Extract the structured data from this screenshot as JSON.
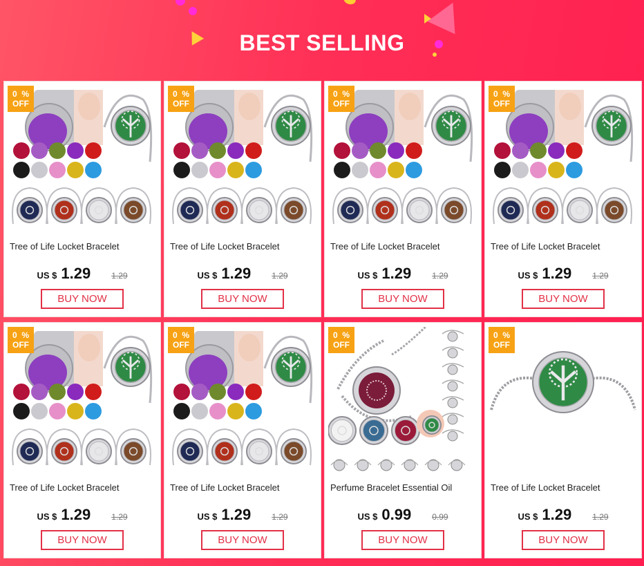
{
  "header": {
    "title": "BEST SELLING"
  },
  "products": [
    {
      "discount_value": "0",
      "discount_unit": "%",
      "discount_label": "OFF",
      "title": "Tree of Life Locket Bracelet",
      "currency": "US $",
      "price": "1.29",
      "original_price": "1.29",
      "button": "BUY NOW",
      "image_style": "set"
    },
    {
      "discount_value": "0",
      "discount_unit": "%",
      "discount_label": "OFF",
      "title": "Tree of Life Locket Bracelet",
      "currency": "US $",
      "price": "1.29",
      "original_price": "1.29",
      "button": "BUY NOW",
      "image_style": "set"
    },
    {
      "discount_value": "0",
      "discount_unit": "%",
      "discount_label": "OFF",
      "title": "Tree of Life Locket Bracelet",
      "currency": "US $",
      "price": "1.29",
      "original_price": "1.29",
      "button": "BUY NOW",
      "image_style": "set"
    },
    {
      "discount_value": "0",
      "discount_unit": "%",
      "discount_label": "OFF",
      "title": "Tree of Life Locket Bracelet",
      "currency": "US $",
      "price": "1.29",
      "original_price": "1.29",
      "button": "BUY NOW",
      "image_style": "set"
    },
    {
      "discount_value": "0",
      "discount_unit": "%",
      "discount_label": "OFF",
      "title": "Tree of Life Locket Bracelet",
      "currency": "US $",
      "price": "1.29",
      "original_price": "1.29",
      "button": "BUY NOW",
      "image_style": "set"
    },
    {
      "discount_value": "0",
      "discount_unit": "%",
      "discount_label": "OFF",
      "title": "Tree of Life Locket Bracelet",
      "currency": "US $",
      "price": "1.29",
      "original_price": "1.29",
      "button": "BUY NOW",
      "image_style": "set"
    },
    {
      "discount_value": "0",
      "discount_unit": "%",
      "discount_label": "OFF",
      "title": "Perfume Bracelet Essential Oil",
      "currency": "US $",
      "price": "0.99",
      "original_price": "0.99",
      "button": "BUY NOW",
      "image_style": "chain"
    },
    {
      "discount_value": "0",
      "discount_unit": "%",
      "discount_label": "OFF",
      "title": "Tree of Life Locket Bracelet",
      "currency": "US $",
      "price": "1.29",
      "original_price": "1.29",
      "button": "BUY NOW",
      "image_style": "single"
    }
  ],
  "colors": {
    "background": "#ff2f56",
    "badge": "#f7a214",
    "button_border": "#e23046",
    "pad_colors": [
      "#b3123a",
      "#a55bc4",
      "#6f8a2c",
      "#8a2bbd",
      "#d11c1c",
      "#1b1b1b",
      "#c9c9cf",
      "#e78fc9",
      "#d9b51c",
      "#2d9be0"
    ]
  }
}
